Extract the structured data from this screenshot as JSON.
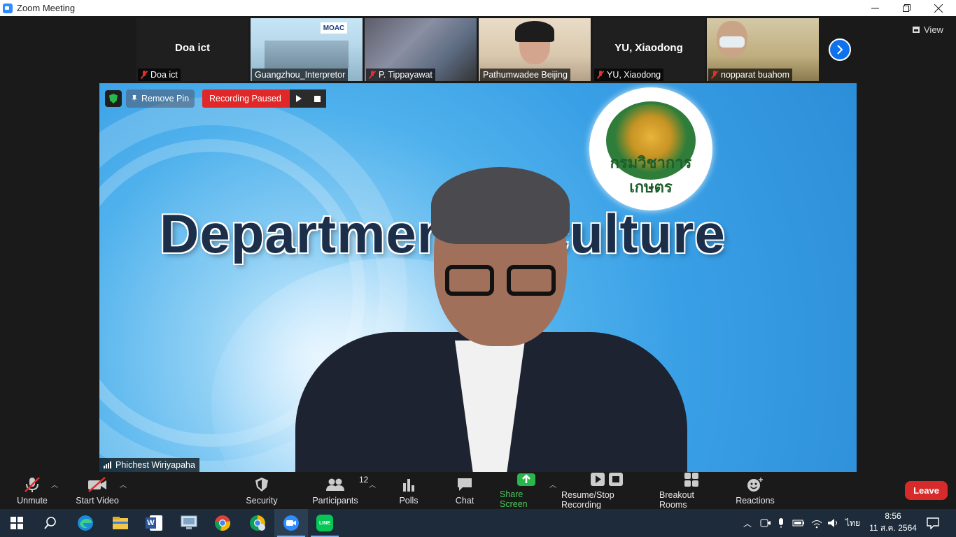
{
  "window": {
    "title": "Zoom Meeting",
    "controls": [
      "minimize-icon",
      "restore-icon",
      "close-icon"
    ]
  },
  "gallery": {
    "participants": [
      {
        "display": "Doa ict",
        "label": "Doa ict",
        "muted": true,
        "video": false
      },
      {
        "display": "",
        "label": "Guangzhou_Interpretor",
        "muted": false,
        "video": true,
        "overlay_logo": "MOAC"
      },
      {
        "display": "",
        "label": "P. Tippayawat",
        "muted": true,
        "video": true
      },
      {
        "display": "",
        "label": "Pathumwadee Beijing",
        "muted": false,
        "video": true
      },
      {
        "display": "YU, Xiaodong",
        "label": "YU, Xiaodong",
        "muted": true,
        "video": false
      },
      {
        "display": "",
        "label": "nopparat buahom",
        "muted": true,
        "video": true
      }
    ],
    "next_icon": "chevron-right-icon",
    "view_label": "View"
  },
  "main_video": {
    "banner_text": "Departmen     griculture",
    "seal_text": "กรมวิชาการเกษตร",
    "pin_label": "Remove Pin",
    "recording_label": "Recording Paused",
    "speaker_name": "Phichest Wiriyapaha"
  },
  "toolbar": {
    "unmute": "Unmute",
    "start_video": "Start Video",
    "security": "Security",
    "participants": "Participants",
    "participants_count": "12",
    "polls": "Polls",
    "chat": "Chat",
    "share_screen": "Share Screen",
    "recording": "Resume/Stop Recording",
    "breakout": "Breakout Rooms",
    "reactions": "Reactions",
    "leave": "Leave"
  },
  "taskbar": {
    "apps": [
      "windows-start-icon",
      "search-icon",
      "edge-icon",
      "file-explorer-icon",
      "word-icon",
      "remote-desktop-icon",
      "chrome-icon",
      "chrome-alt-icon",
      "zoom-icon",
      "line-icon"
    ],
    "line_badge": "LINE",
    "word_badge": "W",
    "language": "ไทย",
    "time": "8:56",
    "date": "11 ส.ค. 2564"
  },
  "colors": {
    "zoom_blue": "#0e72ed",
    "recording_red": "#e02828",
    "leave_red": "#d72b2b",
    "share_green": "#4ac95a",
    "taskbar": "#1d2b3a"
  }
}
